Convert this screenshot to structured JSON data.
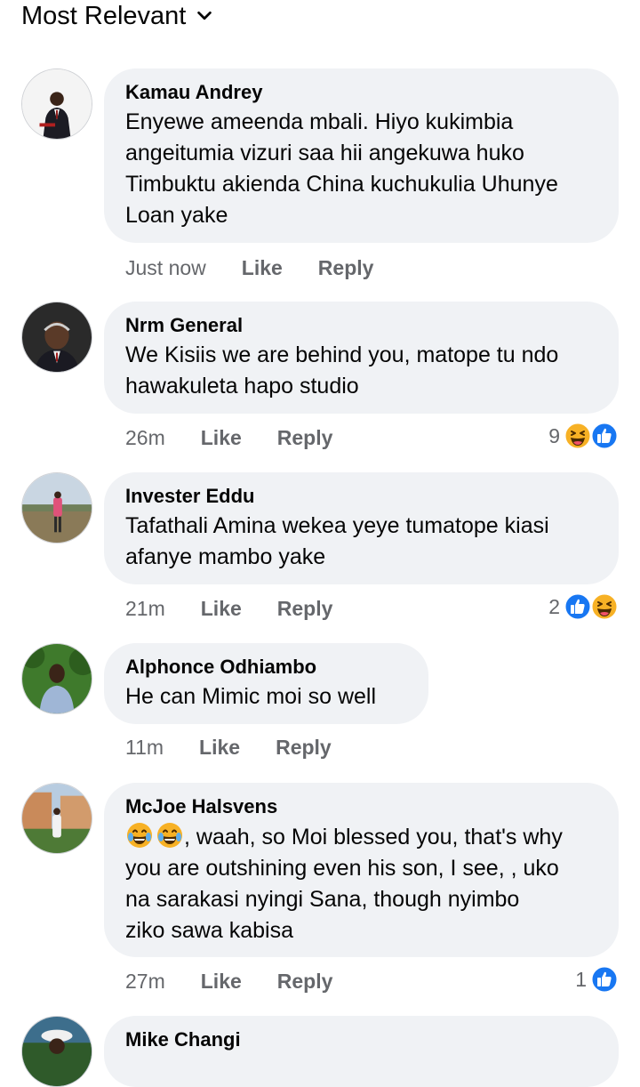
{
  "sort": {
    "label": "Most Relevant",
    "icon": "chevron-down-icon"
  },
  "actions": {
    "like": "Like",
    "reply": "Reply"
  },
  "comments": [
    {
      "author": "Kamau Andrey",
      "text": "Enyewe ameenda mbali. Hiyo kukimbia\nangeitumia vizuri saa hii angekuwa huko\nTimbuktu akienda China kuchukulia Uhunye\nLoan yake",
      "time": "Just now"
    },
    {
      "author": "Nrm General",
      "text": "We Kisiis we are behind you, matope tu ndo\nhawakuleta hapo studio",
      "time": "26m",
      "reaction_count": "9",
      "reaction_icons": [
        "haha-icon",
        "like-reaction-icon"
      ]
    },
    {
      "author": "Invester Eddu",
      "text": "Tafathali Amina wekea yeye tumatope kiasi\nafanye mambo yake",
      "time": "21m",
      "reaction_count": "2",
      "reaction_icons": [
        "like-reaction-icon",
        "haha-icon"
      ]
    },
    {
      "author": "Alphonce Odhiambo",
      "text": "He can Mimic moi so well",
      "time": "11m"
    },
    {
      "author": "McJoe Halsvens",
      "text": ", waah, so Moi blessed you, that's why\nyou are outshining even his son, I see, , uko\nna sarakasi nyingi Sana, though nyimbo\nziko sawa kabisa",
      "emoji_prefix": [
        "tears-of-joy-emoji",
        "tears-of-joy-emoji"
      ],
      "time": "27m",
      "reaction_count": "1",
      "reaction_icons": [
        "like-reaction-icon"
      ]
    },
    {
      "author": "Mike Changi",
      "text": "",
      "time": ""
    }
  ]
}
